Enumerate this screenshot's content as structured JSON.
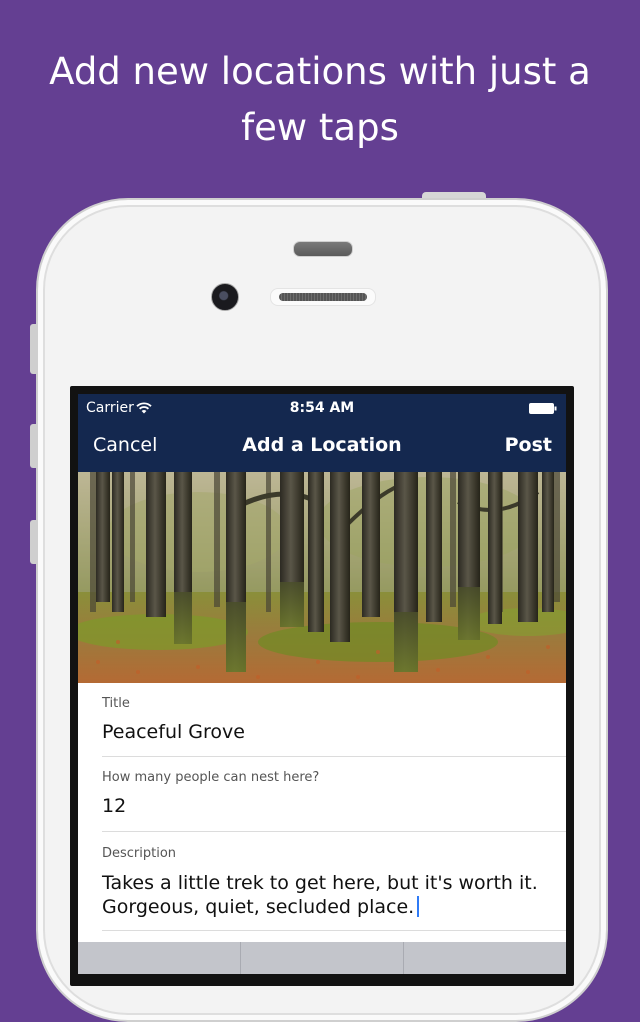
{
  "headline": "Add new locations with just a few taps",
  "status_bar": {
    "carrier": "Carrier",
    "time": "8:54 AM",
    "wifi_icon": "wifi-icon",
    "battery_icon": "battery-icon"
  },
  "nav": {
    "cancel": "Cancel",
    "title": "Add a Location",
    "post": "Post",
    "background": "#14284f"
  },
  "photo": {
    "subject": "forest-photo"
  },
  "form": {
    "title_label": "Title",
    "title_value": "Peaceful Grove",
    "capacity_label": "How many people can nest here?",
    "capacity_value": "12",
    "description_label": "Description",
    "description_value": "Takes a little trek to get here, but it's worth it. Gorgeous, quiet, secluded place."
  },
  "colors": {
    "background": "#643f92",
    "caret": "#2f7bf6"
  }
}
